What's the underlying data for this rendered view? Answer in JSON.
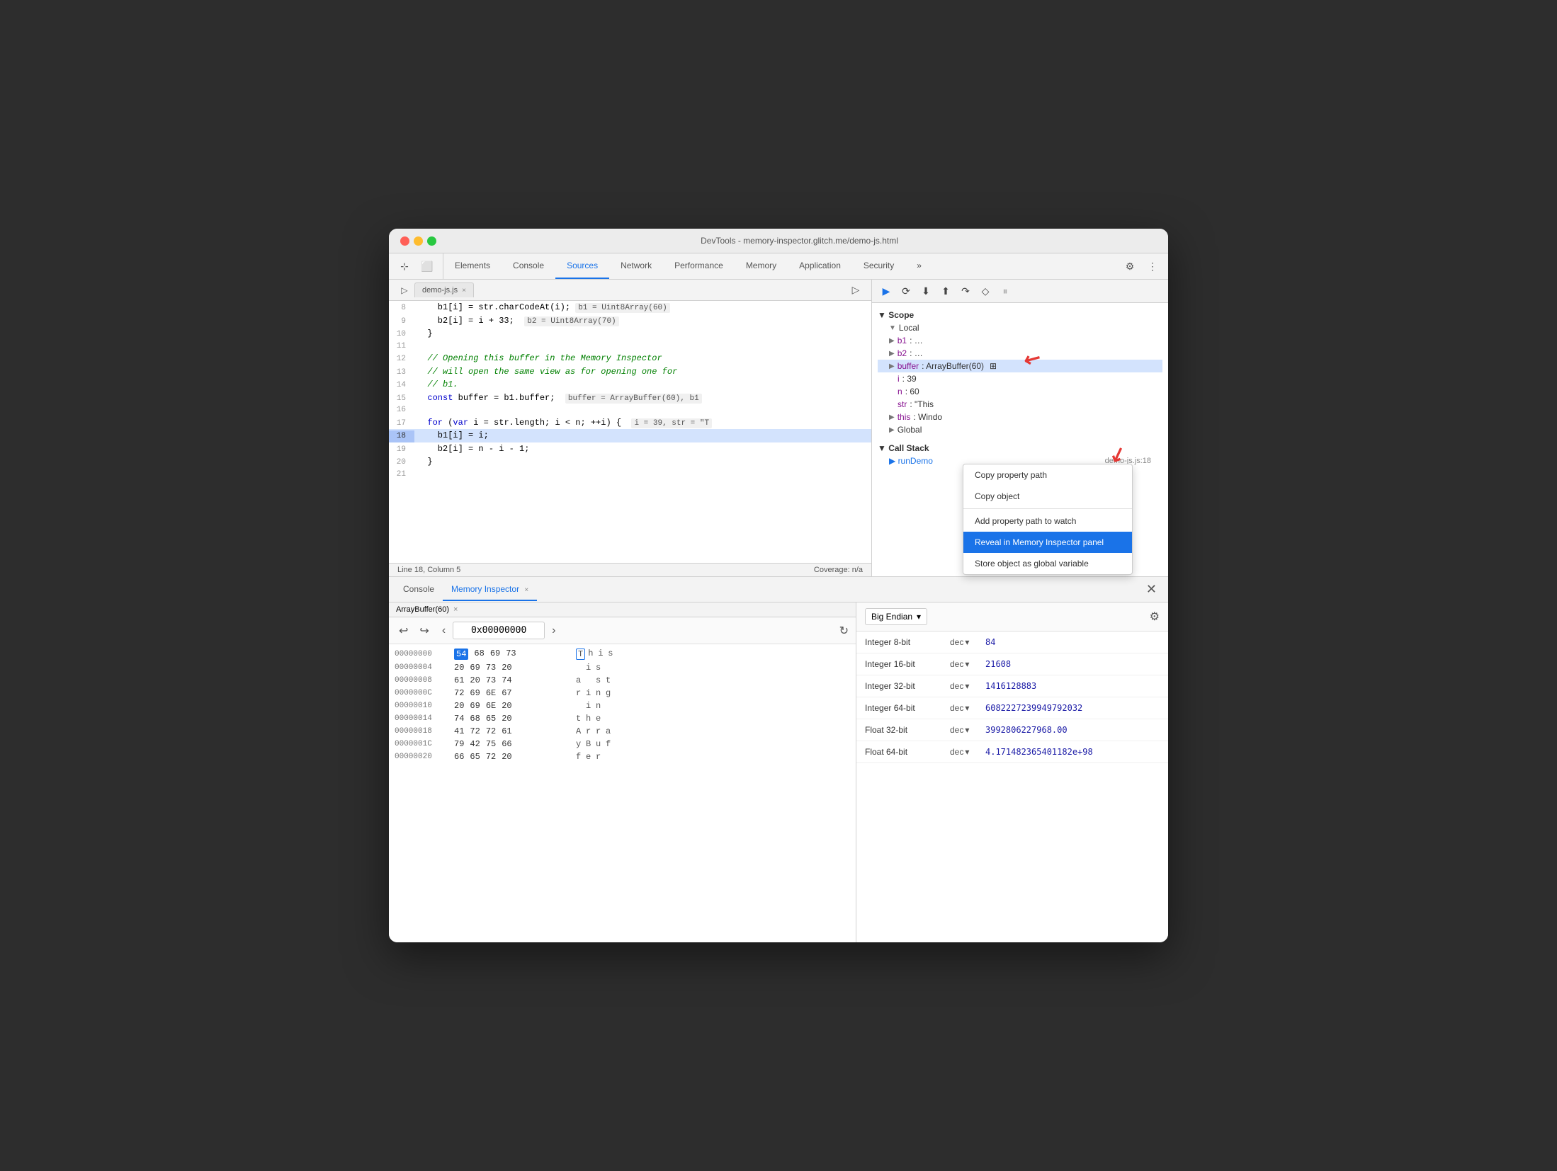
{
  "window": {
    "title": "DevTools - memory-inspector.glitch.me/demo-js.html",
    "traffic_lights": [
      "red",
      "yellow",
      "green"
    ]
  },
  "header": {
    "tabs": [
      {
        "label": "Elements",
        "active": false
      },
      {
        "label": "Console",
        "active": false
      },
      {
        "label": "Sources",
        "active": true
      },
      {
        "label": "Network",
        "active": false
      },
      {
        "label": "Performance",
        "active": false
      },
      {
        "label": "Memory",
        "active": false
      },
      {
        "label": "Application",
        "active": false
      },
      {
        "label": "Security",
        "active": false
      }
    ],
    "more_tabs": "»"
  },
  "source_panel": {
    "tab_label": "demo-js.js",
    "tab_close": "×",
    "lines": [
      {
        "num": "8",
        "content": "    b1[i] = str.charCodeAt(i);",
        "inline": "b1 = Uint8Array(60)"
      },
      {
        "num": "9",
        "content": "    b2[i] = i + 33;",
        "inline": "b2 = Uint8Array(70)"
      },
      {
        "num": "10",
        "content": "  }"
      },
      {
        "num": "11",
        "content": ""
      },
      {
        "num": "12",
        "content": "  // Opening this buffer in the Memory Inspector"
      },
      {
        "num": "13",
        "content": "  // will open the same view as for opening one for"
      },
      {
        "num": "14",
        "content": "  // b1."
      },
      {
        "num": "15",
        "content": "  const buffer = b1.buffer;",
        "inline": "buffer = ArrayBuffer(60), b1"
      },
      {
        "num": "16",
        "content": ""
      },
      {
        "num": "17",
        "content": "  for (var i = str.length; i < n; ++i) {",
        "inline": "i = 39, str = \"T"
      },
      {
        "num": "18",
        "content": "    b1[i] = i;",
        "highlighted": true
      },
      {
        "num": "19",
        "content": "    b2[i] = n - i - 1;"
      },
      {
        "num": "20",
        "content": "  }"
      },
      {
        "num": "21",
        "content": ""
      }
    ],
    "status_left": "Line 18, Column 5",
    "status_right": "Coverage: n/a"
  },
  "debug_panel": {
    "toolbar_buttons": [
      "▶",
      "⟳",
      "⬇",
      "⬆",
      "↗",
      "◇",
      "⏸"
    ],
    "scope_label": "▼ Scope",
    "local_label": "▼ Local",
    "items": [
      {
        "key": "b1",
        "val": "…"
      },
      {
        "key": "b2",
        "val": "…"
      },
      {
        "key": "buffer",
        "val": "ArrayBuffer(60)",
        "has_icon": true
      },
      {
        "key": "i",
        "val": "39"
      },
      {
        "key": "n",
        "val": "60"
      },
      {
        "key": "str",
        "val": "\"This"
      },
      {
        "key": "this",
        "val": "Windo"
      }
    ],
    "global_label": "▶ Global",
    "call_stack_label": "▼ Call Stack",
    "call_stack_item": "runDemo",
    "call_stack_location": "demo-js.js:18"
  },
  "context_menu": {
    "items": [
      {
        "label": "Copy property path",
        "type": "normal"
      },
      {
        "label": "Copy object",
        "type": "normal"
      },
      {
        "label": "Add property path to watch",
        "type": "normal"
      },
      {
        "label": "Reveal in Memory Inspector panel",
        "type": "selected"
      },
      {
        "label": "Store object as global variable",
        "type": "normal"
      }
    ]
  },
  "bottom_panel": {
    "tab_console": "Console",
    "tab_memory": "Memory Inspector",
    "tab_memory_close": "×",
    "array_buf_label": "ArrayBuffer(60)",
    "array_buf_close": "×"
  },
  "mem_toolbar": {
    "back_btn": "↩",
    "forward_btn": "↪",
    "prev_btn": "‹",
    "next_btn": "›",
    "address_value": "0x00000000",
    "reload_btn": "↻"
  },
  "mem_rows": [
    {
      "addr": "00000000",
      "bytes": [
        "54",
        "68",
        "69",
        "73"
      ],
      "chars": [
        "T",
        "h",
        "i",
        "s"
      ],
      "selected_byte": 0
    },
    {
      "addr": "00000004",
      "bytes": [
        "20",
        "69",
        "73",
        "20"
      ],
      "chars": [
        "i",
        "s"
      ]
    },
    {
      "addr": "00000008",
      "bytes": [
        "61",
        "20",
        "73",
        "74"
      ],
      "chars": [
        "a",
        "s",
        "t"
      ]
    },
    {
      "addr": "0000000C",
      "bytes": [
        "72",
        "69",
        "6E",
        "67"
      ],
      "chars": [
        "r",
        "i",
        "n",
        "g"
      ]
    },
    {
      "addr": "00000010",
      "bytes": [
        "20",
        "69",
        "6E",
        "20"
      ],
      "chars": [
        "i",
        "n"
      ]
    },
    {
      "addr": "00000014",
      "bytes": [
        "74",
        "68",
        "65",
        "20"
      ],
      "chars": [
        "t",
        "h",
        "e"
      ]
    },
    {
      "addr": "00000018",
      "bytes": [
        "41",
        "72",
        "72",
        "61"
      ],
      "chars": [
        "A",
        "r",
        "r",
        "a"
      ]
    },
    {
      "addr": "0000001C",
      "bytes": [
        "79",
        "42",
        "75",
        "66"
      ],
      "chars": [
        "y",
        "B",
        "u",
        "f"
      ]
    },
    {
      "addr": "00000020",
      "bytes": [
        "66",
        "65",
        "72",
        "20"
      ],
      "chars": [
        "f",
        "e",
        "r"
      ]
    }
  ],
  "mem_right": {
    "endian_label": "Big Endian",
    "settings_icon": "⚙",
    "data_rows": [
      {
        "type": "Integer 8-bit",
        "fmt": "dec",
        "value": "84"
      },
      {
        "type": "Integer 16-bit",
        "fmt": "dec",
        "value": "21608"
      },
      {
        "type": "Integer 32-bit",
        "fmt": "dec",
        "value": "1416128883"
      },
      {
        "type": "Integer 64-bit",
        "fmt": "dec",
        "value": "6082227239949792032"
      },
      {
        "type": "Float 32-bit",
        "fmt": "dec",
        "value": "3992806227968.00"
      },
      {
        "type": "Float 64-bit",
        "fmt": "dec",
        "value": "4.171482365401182e+98"
      }
    ]
  }
}
